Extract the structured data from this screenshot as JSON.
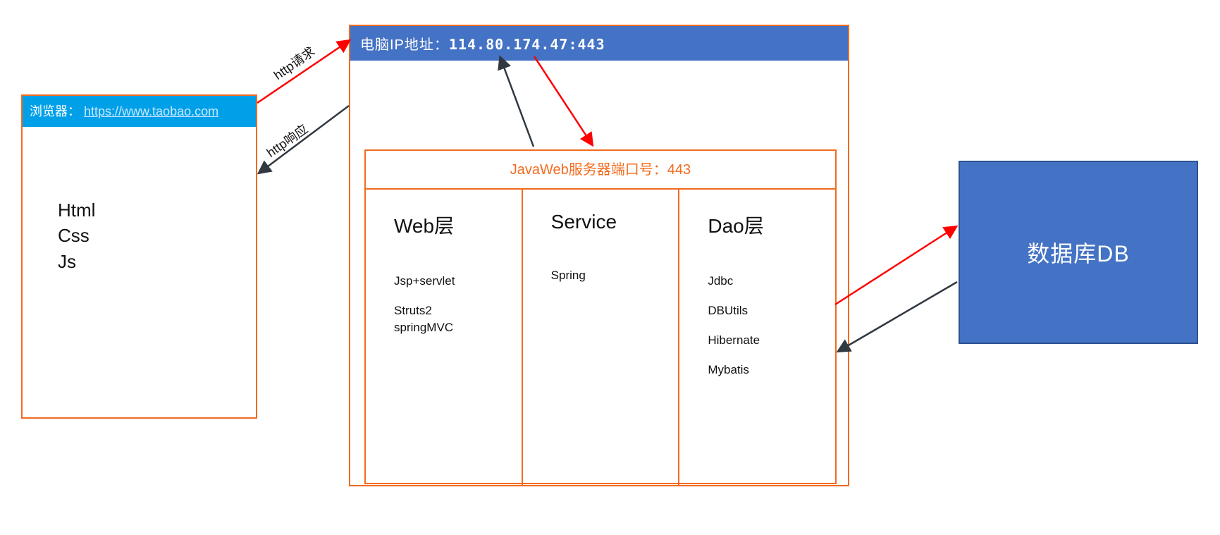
{
  "browser": {
    "title_prefix": "浏览器：",
    "url": "https://www.taobao.com",
    "tech": [
      "Html",
      "Css",
      "Js"
    ]
  },
  "arrows": {
    "http_request_label": "http请求",
    "http_response_label": "http响应"
  },
  "server": {
    "title_prefix": "电脑IP地址：",
    "ip": "114.80.174.47:443",
    "javaweb": {
      "title": "JavaWeb服务器端口号：443",
      "columns": [
        {
          "heading": "Web层",
          "items": [
            "Jsp+servlet",
            "Struts2",
            "springMVC"
          ]
        },
        {
          "heading": "Service",
          "items": [
            "Spring"
          ]
        },
        {
          "heading": "Dao层",
          "items": [
            "Jdbc",
            "DBUtils",
            "Hibernate",
            "Mybatis"
          ]
        }
      ]
    }
  },
  "database": {
    "label": "数据库DB"
  },
  "colors": {
    "orange": "#f26b1f",
    "blue_header": "#4472c4",
    "cyan": "#00a0e9",
    "red_arrow": "#ff0000",
    "dark_arrow": "#303841"
  }
}
